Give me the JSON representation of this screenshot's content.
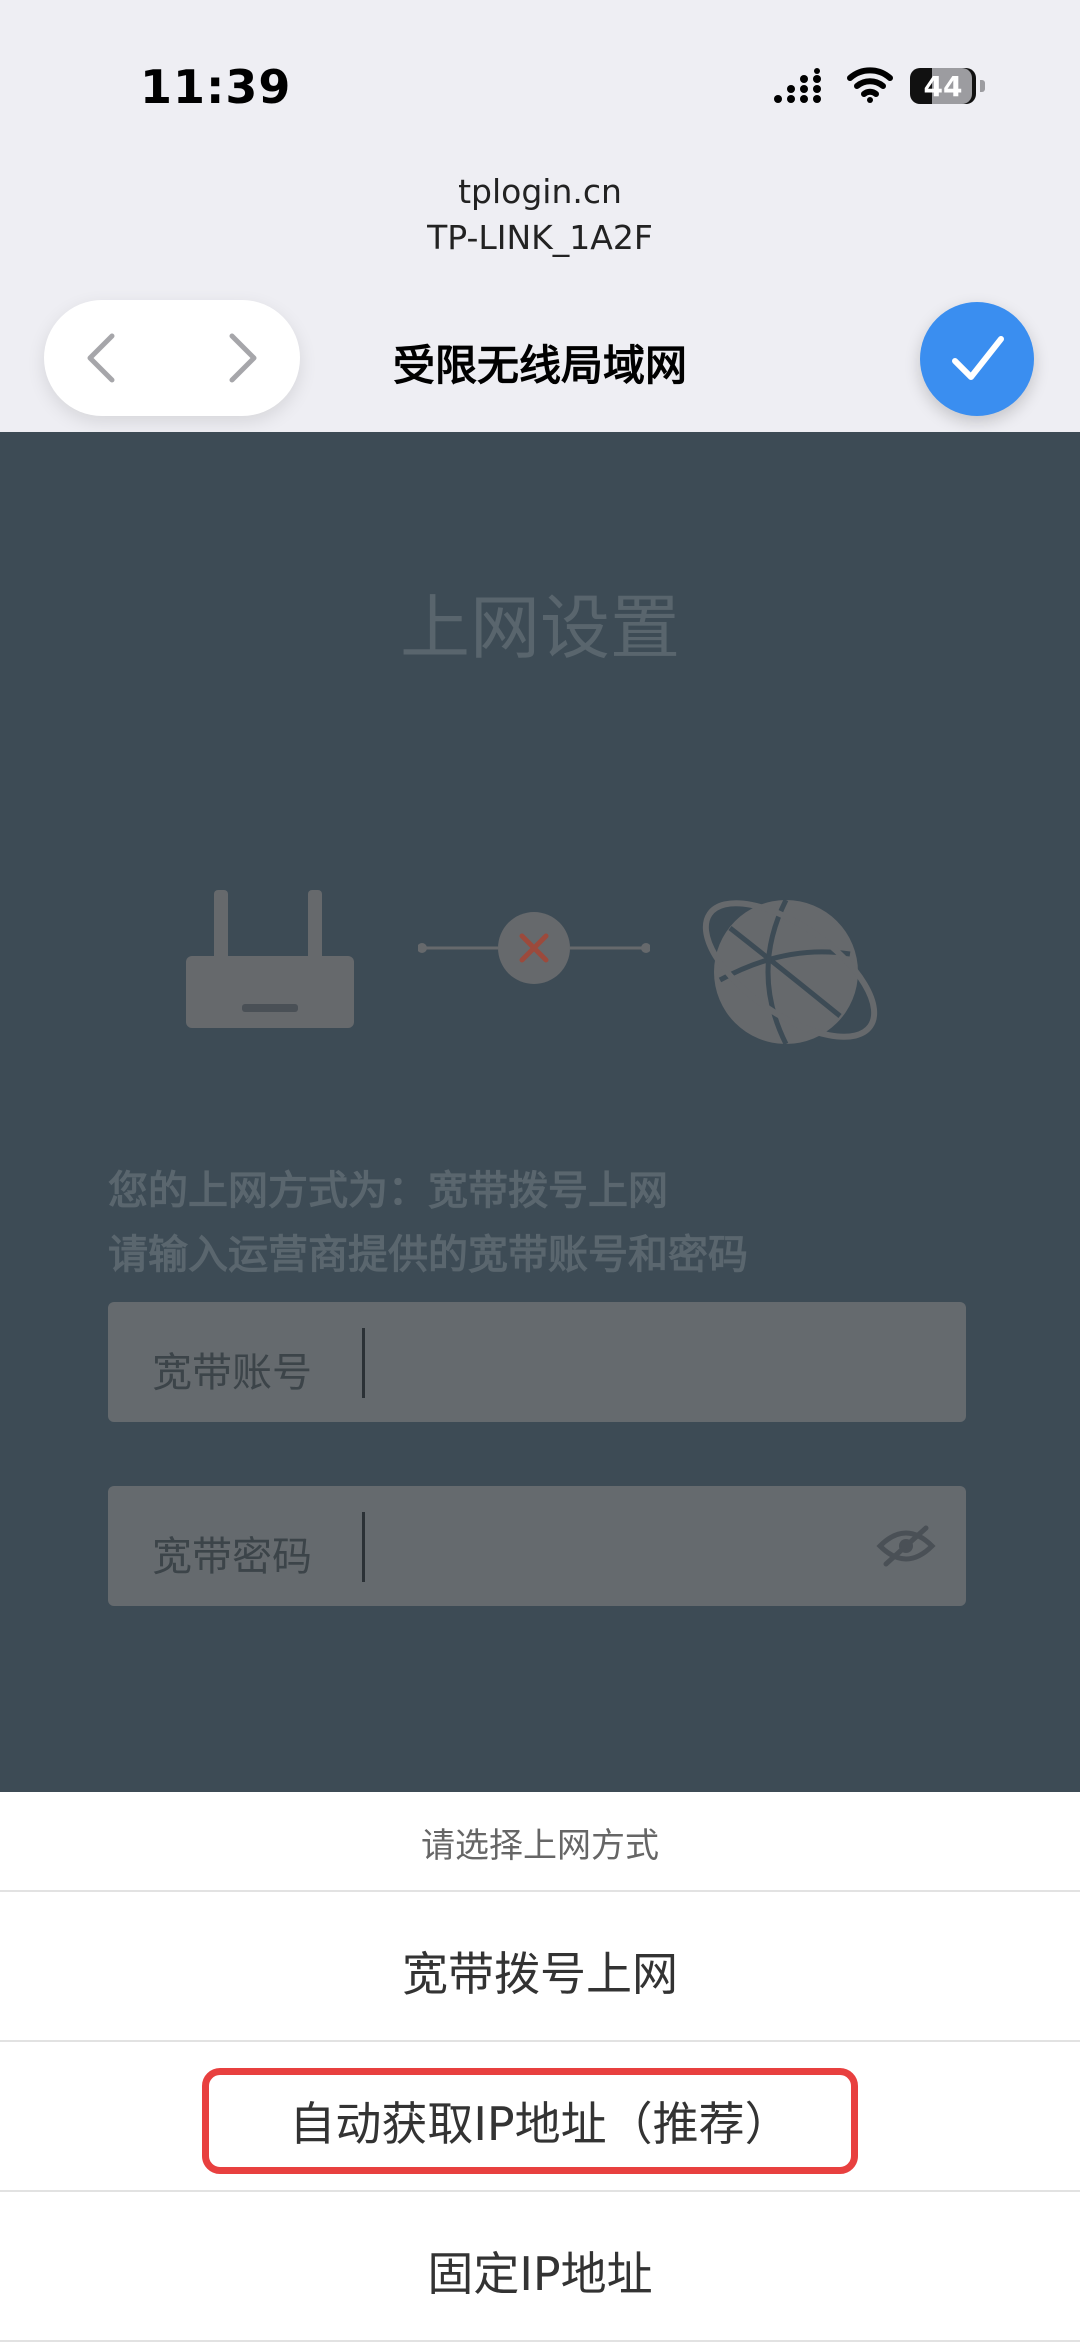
{
  "status_bar": {
    "time": "11:39",
    "battery": "44"
  },
  "browser": {
    "host": "tplogin.cn",
    "network_name": "TP-LINK_1A2F",
    "page_heading": "受限无线局域网"
  },
  "page": {
    "title": "上网设置",
    "mode_line": "您的上网方式为：宽带拨号上网",
    "hint_line": "请输入运营商提供的宽带账号和密码",
    "account_label": "宽带账号",
    "password_label": "宽带密码"
  },
  "sheet": {
    "title": "请选择上网方式",
    "options": [
      "宽带拨号上网",
      "自动获取IP地址（推荐）",
      "固定IP地址"
    ],
    "highlighted_option_index": 1
  },
  "colors": {
    "accent": "#3a8ef0",
    "highlight": "#e8403f",
    "overlay": "#3d4b55"
  }
}
